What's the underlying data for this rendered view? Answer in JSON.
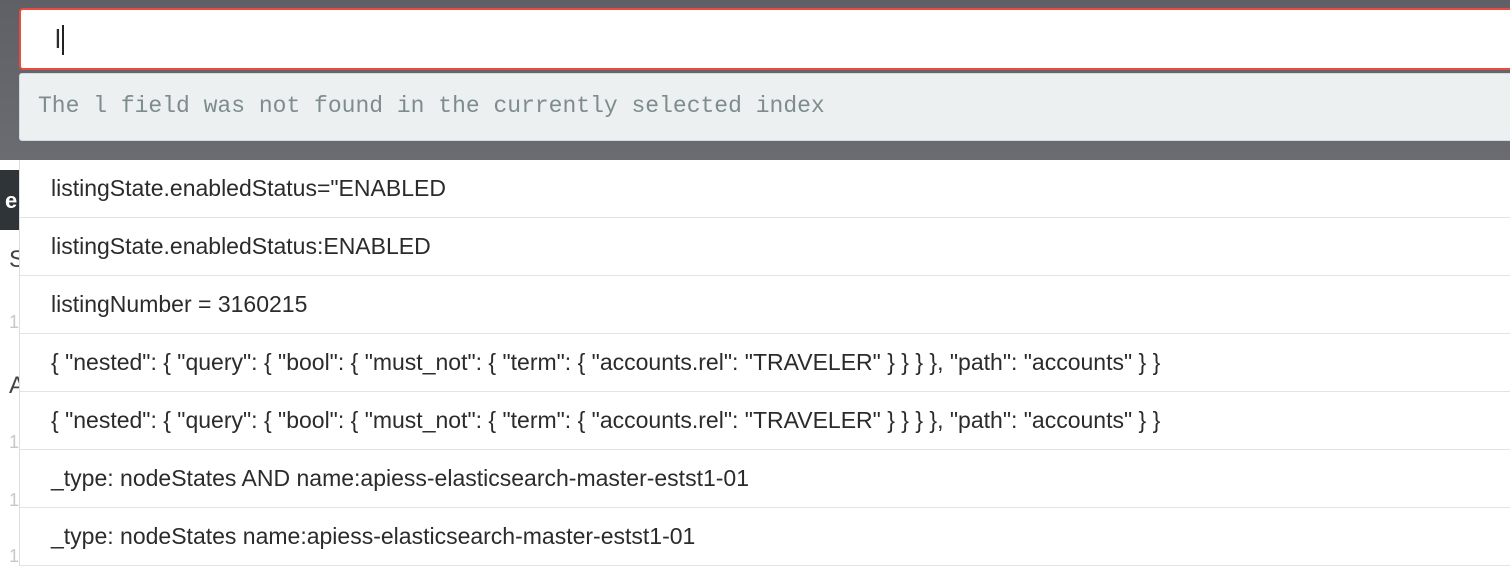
{
  "background": {
    "navbar_char": "e",
    "side_chars": [
      "S",
      "1",
      "A",
      "1",
      "1",
      "1"
    ]
  },
  "search": {
    "value": "l"
  },
  "error": {
    "message": "The l field was not found in the currently selected index"
  },
  "suggestions": [
    "listingState.enabledStatus=\"ENABLED",
    "listingState.enabledStatus:ENABLED",
    "listingNumber = 3160215",
    "{ \"nested\": { \"query\": { \"bool\": { \"must_not\": { \"term\": { \"accounts.rel\": \"TRAVELER\" } } } }, \"path\": \"accounts\" } }",
    "{ \"nested\": { \"query\": { \"bool\": { \"must_not\": { \"term\": { \"accounts.rel\": \"TRAVELER\" } } } }, \"path\": \"accounts\" } }",
    "_type: nodeStates AND name:apiess-elasticsearch-master-estst1-01",
    "_type: nodeStates name:apiess-elasticsearch-master-estst1-01"
  ],
  "colors": {
    "input_border_error": "#e74c3c",
    "error_bg": "#ecf0f1",
    "error_text": "#7f8c8d",
    "header_bg": "#65666b"
  }
}
